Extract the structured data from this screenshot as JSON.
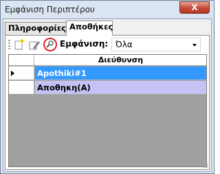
{
  "window": {
    "title": "Εμφάνιση Περιπτέρου",
    "close_label": "X"
  },
  "tabs": [
    {
      "label": "Πληροφορίες",
      "selected": false
    },
    {
      "label": "Αποθήκες",
      "selected": true
    }
  ],
  "toolbar": {
    "buttons": [
      {
        "icon": "new-document-icon"
      },
      {
        "icon": "edit-pencil-icon"
      },
      {
        "icon": "magnifier-search-icon"
      }
    ],
    "show_label": "Εμφάνιση:",
    "filter_value": "Όλα"
  },
  "grid": {
    "column_header": "Διεύθυνση",
    "rows": [
      {
        "address": "Apothiki#1",
        "selected": true,
        "color": "#3399ff"
      },
      {
        "address": "Αποθηκη(Α)",
        "selected": false,
        "color": "#c5c3f5"
      }
    ]
  },
  "colors": {
    "window_bg": "#dbe5f1",
    "selected_row": "#3399ff",
    "alt_row": "#c5c3f5",
    "grid_bg": "#a0a0a0",
    "close_button": "#c8493a",
    "highlight_circle": "#e31e24"
  }
}
